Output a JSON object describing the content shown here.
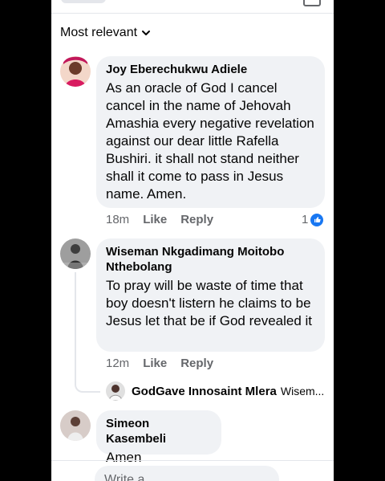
{
  "sort": {
    "label": "Most relevant",
    "icon": "chevron-down-icon"
  },
  "comments": [
    {
      "author": "Joy Eberechukwu Adiele",
      "text": "As an oracle of God I cancel cancel in the name of Jehovah Amashia  every negative revelation against our dear little Rafella Bushiri. it shall not stand neither shall it come to pass in Jesus name. Amen.",
      "time": "18m",
      "like_label": "Like",
      "reply_label": "Reply",
      "reaction_count": "1"
    },
    {
      "author": "Wiseman Nkgadimang Moitobo Nthebolang",
      "text": "To pray will be waste of time that boy doesn't listern he claims to be Jesus let that be if God revealed it",
      "time": "12m",
      "like_label": "Like",
      "reply_label": "Reply",
      "reply_preview": {
        "author": "GodGave Innosaint Mlera",
        "snippet": "Wisem..."
      }
    },
    {
      "author": "Simeon Kasembeli",
      "text": "Amen"
    }
  ],
  "composer": {
    "placeholder": "Write a..."
  },
  "colors": {
    "accent": "#1877f2",
    "bubble": "#f0f2f5",
    "secondary_text": "#65676b"
  }
}
